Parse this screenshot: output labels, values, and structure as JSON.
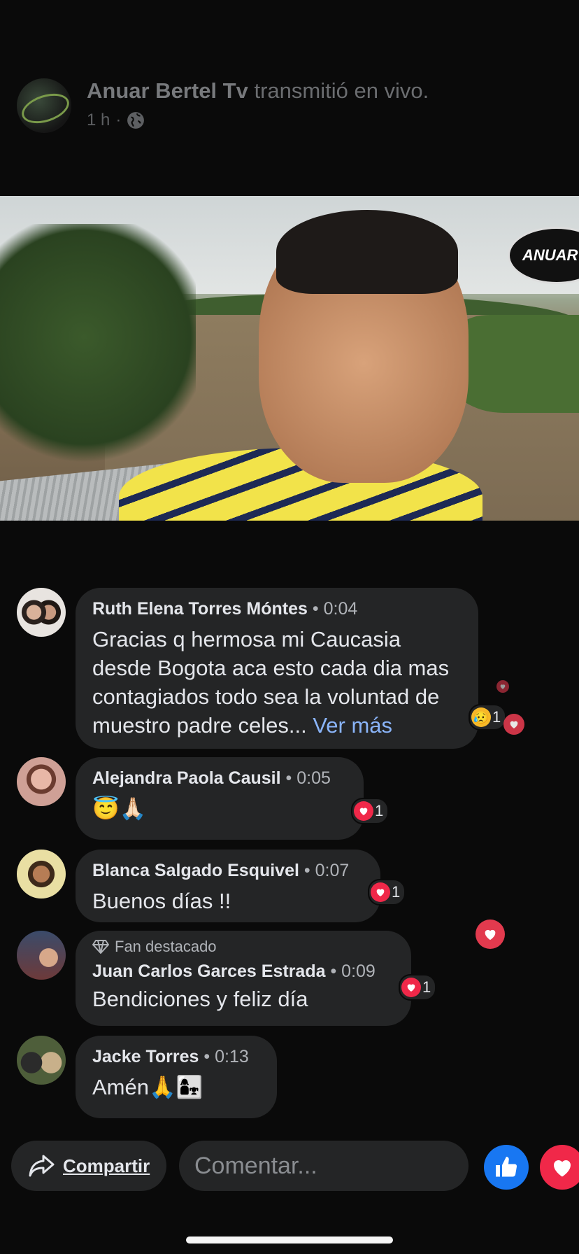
{
  "header": {
    "page_name": "Anuar Bertel Tv",
    "action_text": "transmitió en vivo.",
    "time": "1 h",
    "separator": "·",
    "privacy_icon": "globe-icon"
  },
  "video": {
    "watermark_text": "ANUAR"
  },
  "comments": [
    {
      "name": "Ruth Elena Torres Móntes",
      "dot": "•",
      "time": "0:04",
      "text": "Gracias q hermosa mi Caucasia desde Bogota aca esto cada dia mas contagiados todo sea la voluntad de muestro padre celes...",
      "see_more": "Ver más",
      "reaction_count": "1",
      "reaction_icon": "sad-reaction-icon"
    },
    {
      "name": "Alejandra Paola Causil",
      "dot": "•",
      "time": "0:05",
      "text": "😇🙏🏻",
      "reaction_count": "1",
      "reaction_icon": "heart-reaction-icon"
    },
    {
      "name": "Blanca Salgado Esquivel",
      "dot": "•",
      "time": "0:07",
      "text": "Buenos días !!",
      "reaction_count": "1",
      "reaction_icon": "heart-reaction-icon"
    },
    {
      "badge": "Fan destacado",
      "badge_icon": "diamond-icon",
      "name": "Juan Carlos Garces Estrada",
      "dot": "•",
      "time": "0:09",
      "text": "Bendiciones y feliz día",
      "reaction_count": "1",
      "reaction_icon": "heart-reaction-icon"
    },
    {
      "name": "Jacke Torres",
      "dot": "•",
      "time": "0:13",
      "text": "Amén🙏👩‍👧"
    }
  ],
  "bottom_bar": {
    "share_label": "Compartir",
    "comment_placeholder": "Comentar...",
    "like_icon": "thumbs-up-icon",
    "love_icon": "heart-icon"
  },
  "colors": {
    "background": "#0a0a0a",
    "bubble": "#242526",
    "link": "#8ab4f8",
    "like_blue": "#1877f2",
    "love_red": "#f02849"
  }
}
